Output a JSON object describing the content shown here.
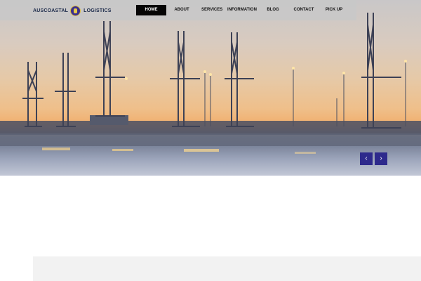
{
  "brand": {
    "name_left": "AUSCOASTAL",
    "name_right": "LOGISTICS",
    "colors": {
      "emblem": "#3a2f8f",
      "emblem_ring": "#d5b640"
    }
  },
  "nav": {
    "items": [
      {
        "label": "HOME",
        "active": true
      },
      {
        "label": "ABOUT",
        "active": false
      },
      {
        "label": "SERVICES",
        "active": false
      },
      {
        "label": "INFORMATION",
        "active": false
      },
      {
        "label": "BLOG",
        "active": false
      },
      {
        "label": "CONTACT",
        "active": false
      },
      {
        "label": "PICK UP",
        "active": false
      }
    ],
    "active_color": "#050505"
  },
  "hero": {
    "image": "port-cranes-sunset-icon"
  },
  "slider": {
    "prev_icon": "chevron-left-icon",
    "next_icon": "chevron-right-icon",
    "prev_glyph": "‹",
    "next_glyph": "›",
    "button_color": "#2e2a8c"
  }
}
